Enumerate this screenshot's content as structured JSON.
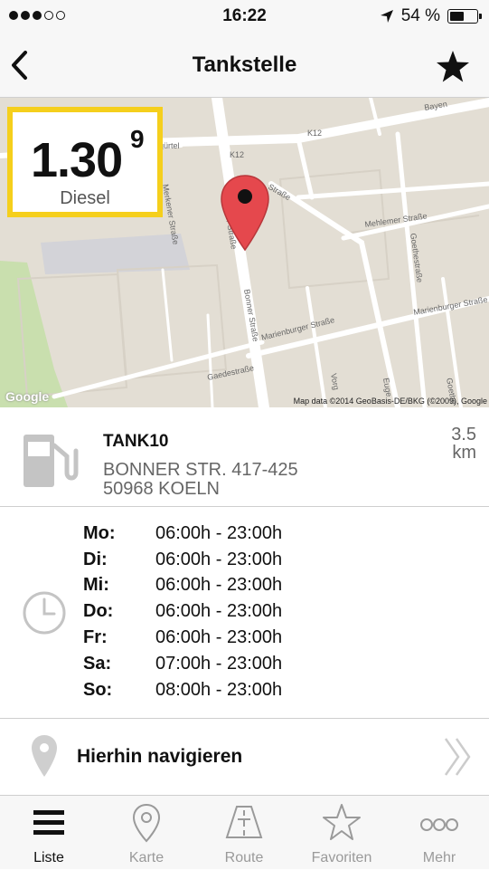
{
  "status_bar": {
    "signal_dots_filled": 3,
    "signal_dots_total": 5,
    "time": "16:22",
    "battery_percent": "54 %",
    "battery_level": 0.54,
    "location_icon": "location-arrow-icon"
  },
  "nav_bar": {
    "title": "Tankstelle",
    "back_icon": "chevron-left-icon",
    "favorite_icon": "star-icon"
  },
  "map": {
    "price_main": "1.30",
    "price_superscript": "9",
    "fuel_type": "Diesel",
    "credit": "Map data ©2014 GeoBasis-DE/BKG (©2009), Google",
    "google_logo": "Google",
    "street_labels": [
      "K12",
      "K12",
      "Bayen",
      "gürtel",
      "Bonner Straße",
      "Bonner Straße",
      "Mehlemer Straße",
      "Goethestraße",
      "Marienburger Straße",
      "Marienburger Straße",
      "Gaedestraße",
      "Merkener Straße",
      "Straße",
      "Vorg",
      "Euge",
      "Goethe"
    ],
    "accent_yellow": "#f5cf1c",
    "pin_color": "#e5484d"
  },
  "station": {
    "name": "TANK10",
    "address_line1": "BONNER STR. 417-425",
    "address_line2": "50968 KOELN",
    "distance_value": "3.5",
    "distance_unit": "km",
    "icon": "fuel-pump-icon"
  },
  "hours": {
    "icon": "clock-icon",
    "rows": [
      {
        "day": "Mo:",
        "time": "06:00h - 23:00h"
      },
      {
        "day": "Di:",
        "time": "06:00h - 23:00h"
      },
      {
        "day": "Mi:",
        "time": "06:00h - 23:00h"
      },
      {
        "day": "Do:",
        "time": "06:00h - 23:00h"
      },
      {
        "day": "Fr:",
        "time": "06:00h - 23:00h"
      },
      {
        "day": "Sa:",
        "time": "07:00h - 23:00h"
      },
      {
        "day": "So:",
        "time": "08:00h - 23:00h"
      }
    ]
  },
  "navigate": {
    "label": "Hierhin navigieren",
    "pin_icon": "map-pin-icon",
    "chevron_icon": "double-chevron-right-icon"
  },
  "tab_bar": {
    "active_index": 0,
    "tabs": [
      {
        "label": "Liste",
        "icon": "list-icon"
      },
      {
        "label": "Karte",
        "icon": "map-pin-icon"
      },
      {
        "label": "Route",
        "icon": "road-icon"
      },
      {
        "label": "Favoriten",
        "icon": "star-icon"
      },
      {
        "label": "Mehr",
        "icon": "more-icon"
      }
    ]
  }
}
